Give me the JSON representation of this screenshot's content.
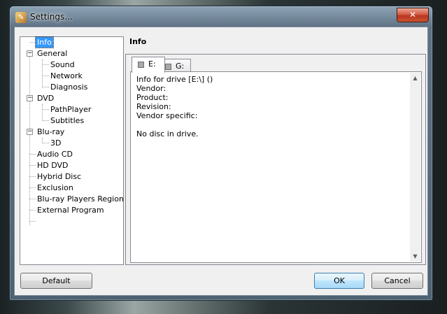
{
  "window": {
    "title": "Settings...",
    "close_label": "✕"
  },
  "tree": {
    "items": [
      {
        "label": "Info",
        "selected": true
      },
      {
        "label": "General",
        "expanded": true
      },
      {
        "label": "Sound"
      },
      {
        "label": "Network"
      },
      {
        "label": "Diagnosis"
      },
      {
        "label": "DVD",
        "expanded": true
      },
      {
        "label": "PathPlayer"
      },
      {
        "label": "Subtitles"
      },
      {
        "label": "Blu-ray",
        "expanded": true
      },
      {
        "label": "3D"
      },
      {
        "label": "Audio CD"
      },
      {
        "label": "HD DVD"
      },
      {
        "label": "Hybrid Disc"
      },
      {
        "label": "Exclusion"
      },
      {
        "label": "Blu-ray Players Region"
      },
      {
        "label": "External Program"
      }
    ]
  },
  "panel": {
    "title": "Info",
    "tabs": [
      {
        "label": "E:",
        "active": true
      },
      {
        "label": "G:",
        "active": false
      }
    ],
    "info_lines": [
      "Info for drive [E:\\] ()",
      "Vendor:",
      "Product:",
      "Revision:",
      "Vendor specific:",
      "",
      "No disc in drive."
    ]
  },
  "buttons": {
    "default_label": "Default",
    "ok_label": "OK",
    "cancel_label": "Cancel"
  },
  "colors": {
    "selection": "#3399ff",
    "close_button": "#c9542f"
  }
}
